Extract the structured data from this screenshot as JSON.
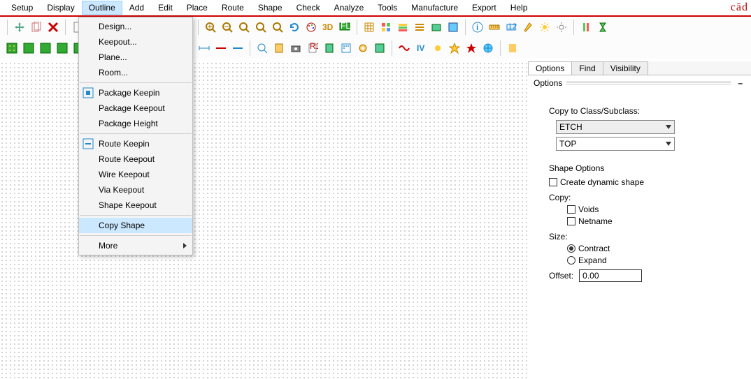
{
  "brand": "cād",
  "menubar": {
    "items": [
      "Setup",
      "Display",
      "Outline",
      "Add",
      "Edit",
      "Place",
      "Route",
      "Shape",
      "Check",
      "Analyze",
      "Tools",
      "Manufacture",
      "Export",
      "Help"
    ],
    "open_index": 2
  },
  "dropdown": {
    "groups": [
      [
        "Design...",
        "Keepout...",
        "Plane...",
        "Room..."
      ],
      [
        "Package Keepin",
        "Package Keepout",
        "Package Height"
      ],
      [
        "Route Keepin",
        "Route Keepout",
        "Wire Keepout",
        "Via Keepout",
        "Shape Keepout"
      ],
      [
        "Copy Shape"
      ],
      [
        "More"
      ]
    ],
    "highlight": "Copy Shape",
    "submenu": "More",
    "icons": {
      "Package Keepin": true,
      "Route Keepin": true
    }
  },
  "panel": {
    "tabs": [
      "Options",
      "Find",
      "Visibility"
    ],
    "active_tab": 0,
    "heading": "Options",
    "section_label": "Copy to Class/Subclass:",
    "class_select": "ETCH",
    "subclass_select": "TOP",
    "shape_options_label": "Shape Options",
    "create_dynamic": "Create dynamic shape",
    "copy_label": "Copy:",
    "voids": "Voids",
    "netname": "Netname",
    "size_label": "Size:",
    "contract": "Contract",
    "expand": "Expand",
    "offset_label": "Offset:",
    "offset_value": "0.00",
    "min_label": "–"
  },
  "toolbar1": [
    "move",
    "copy",
    "delete",
    "sep",
    "new",
    "open",
    "save",
    "sep",
    "rect1",
    "rect2",
    "rect3",
    "rect4",
    "sep",
    "zoomin",
    "zoomout",
    "zoomfit",
    "zoomsel",
    "zoompt",
    "redraw",
    "color",
    "3d",
    "flip",
    "sep",
    "grid",
    "layers",
    "stack",
    "align",
    "manuf",
    "drc",
    "sep",
    "info",
    "measure",
    "ruler",
    "highlight",
    "sun",
    "moon",
    "sep",
    "xsect",
    "hourglass"
  ],
  "toolbar2": [
    "pcb1",
    "pcb2",
    "pcb3",
    "pcb4",
    "pcb5",
    "sep",
    "shape1",
    "shape2",
    "shape3",
    "shape4",
    "shape5",
    "shape6",
    "shape7",
    "shape8",
    "shape9",
    "shape10",
    "shape11",
    "shape12",
    "sep",
    "vis1",
    "vis2",
    "vis3",
    "vis4",
    "vis5",
    "vis6",
    "vis7",
    "vis8",
    "vis9",
    "vis10",
    "sep",
    "wave",
    "iv",
    "sun2",
    "star1",
    "star2",
    "world",
    "sep",
    "end1"
  ]
}
